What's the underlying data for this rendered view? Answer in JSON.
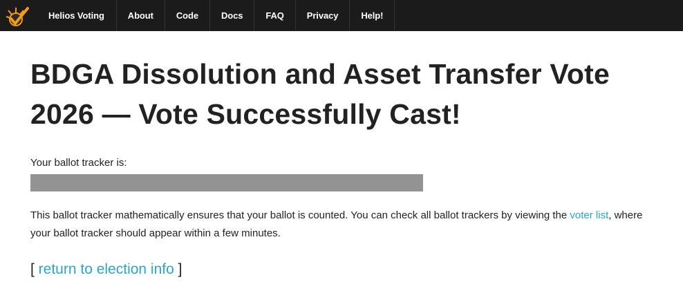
{
  "nav": {
    "logo_icon": "helios-checkmark-logo-icon",
    "brand": "Helios Voting",
    "items": [
      "About",
      "Code",
      "Docs",
      "FAQ",
      "Privacy",
      "Help!"
    ]
  },
  "main": {
    "title_line1": "BDGA Dissolution and Asset Transfer Vote",
    "title_line2": "2026 — Vote Successfully Cast!",
    "tracker_label": "Your ballot tracker is:",
    "tracker_value": "",
    "info_before": "This ballot tracker mathematically ensures that your ballot is counted. You can check all ballot trackers by viewing the ",
    "info_link": "voter list",
    "info_after": ", where your ballot tracker should appear within a few minutes.",
    "return_open": "[ ",
    "return_link": "return to election info",
    "return_close": " ]"
  },
  "colors": {
    "navbar": "#1b1b1b",
    "link": "#2ba6cb",
    "tracker_redaction": "#939393",
    "logo_orange": "#f39c12"
  }
}
